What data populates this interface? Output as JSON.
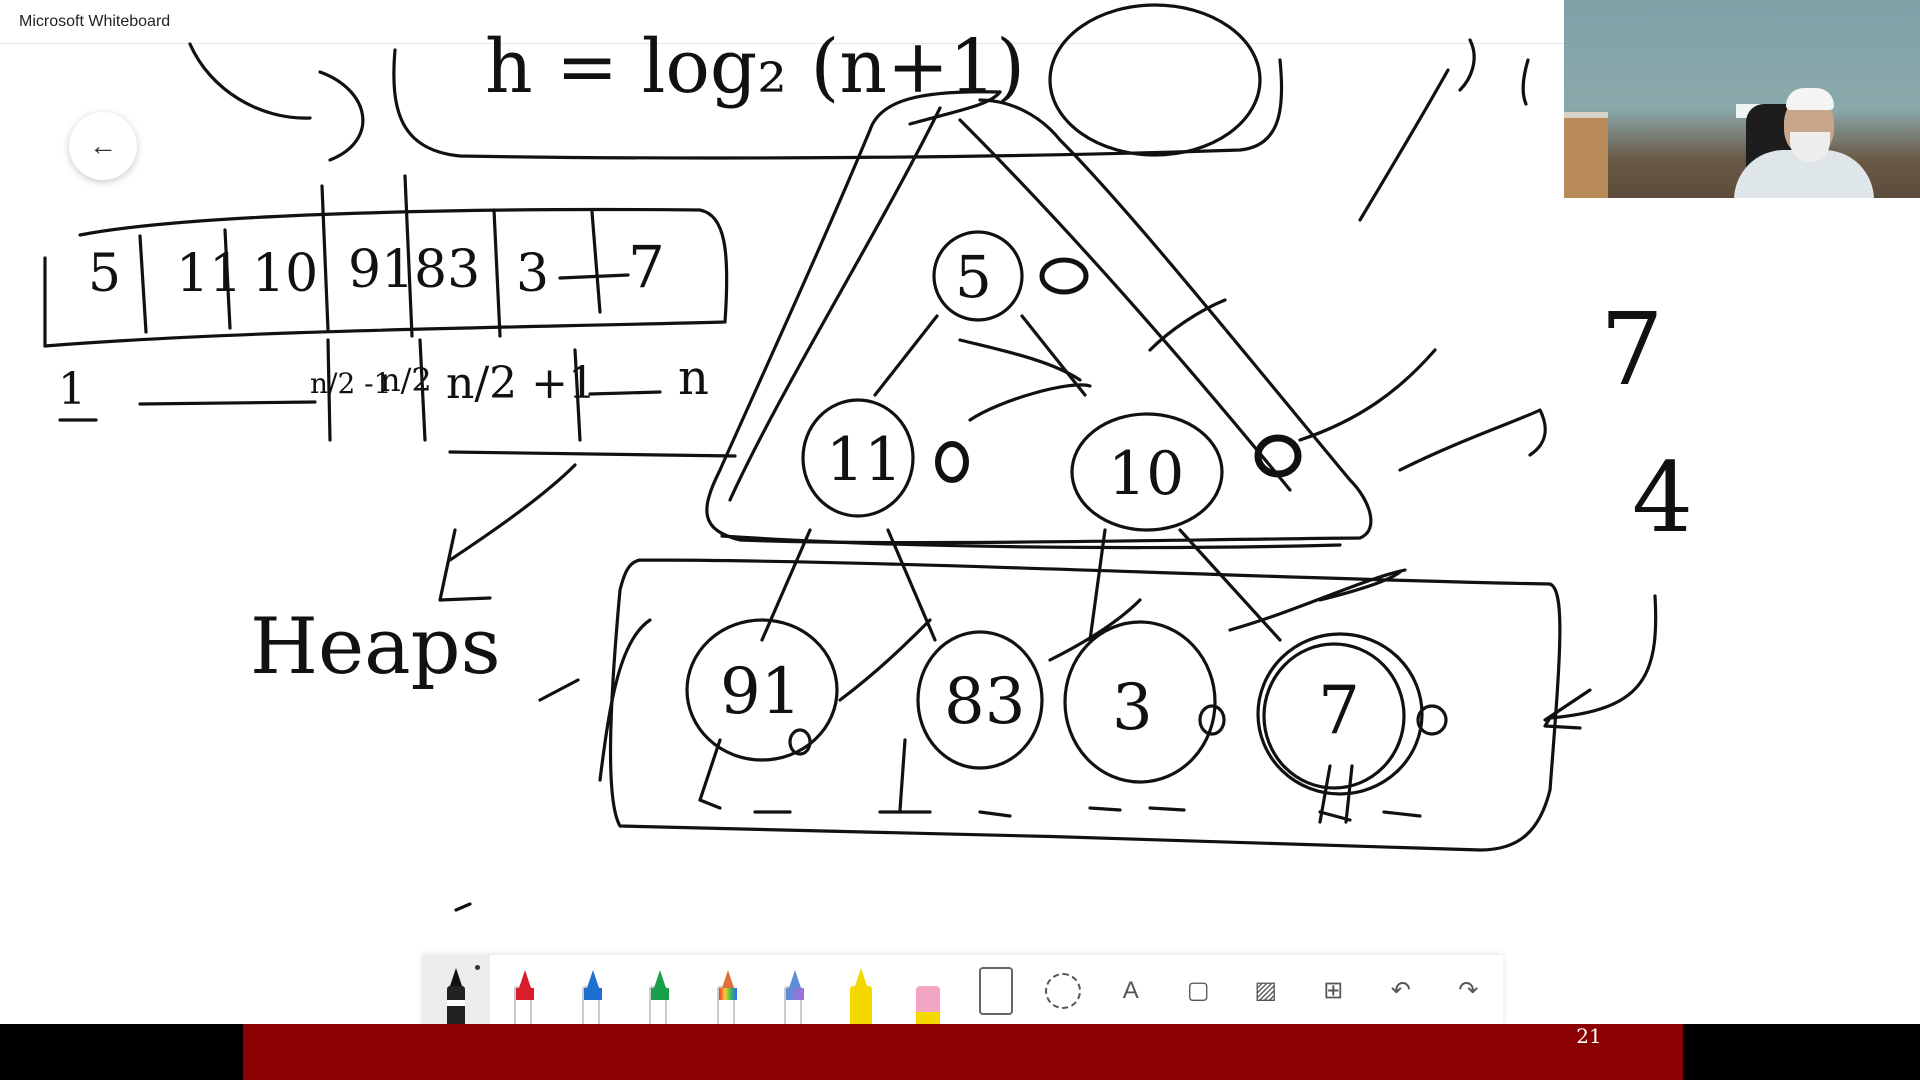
{
  "window": {
    "title": "Microsoft Whiteboard"
  },
  "board": {
    "top_formula": "h = log₂ (n+1)",
    "array_cells": [
      "5",
      "11",
      "10",
      "91",
      "83",
      "3",
      "7"
    ],
    "index_labels": {
      "first": "1",
      "mid_left": "n/2 -1",
      "mid": "n/2",
      "mid_right": "n/2 +1",
      "last": "n"
    },
    "heading": "Heaps",
    "tree": {
      "root": "5",
      "level1": [
        "11",
        "10"
      ],
      "leaves": [
        "91",
        "83",
        "3",
        "7"
      ]
    },
    "side_numbers": [
      "7",
      "4"
    ]
  },
  "toolbar": {
    "tools": [
      {
        "name": "black-pen",
        "color": "#111111"
      },
      {
        "name": "red-pen",
        "color": "#d81e2c"
      },
      {
        "name": "blue-pen",
        "color": "#1f6fd1"
      },
      {
        "name": "green-pen",
        "color": "#1a9e4b"
      },
      {
        "name": "rainbow-pen",
        "color": "#e0703a"
      },
      {
        "name": "galaxy-pen",
        "color": "#5a8fd8"
      },
      {
        "name": "highlighter",
        "color": "#f5d800"
      },
      {
        "name": "eraser",
        "color": "#f3a6c4"
      }
    ]
  },
  "footer": {
    "slide_number": "21"
  },
  "colors": {
    "footer_red": "#8b0000",
    "ink": "#111111"
  }
}
